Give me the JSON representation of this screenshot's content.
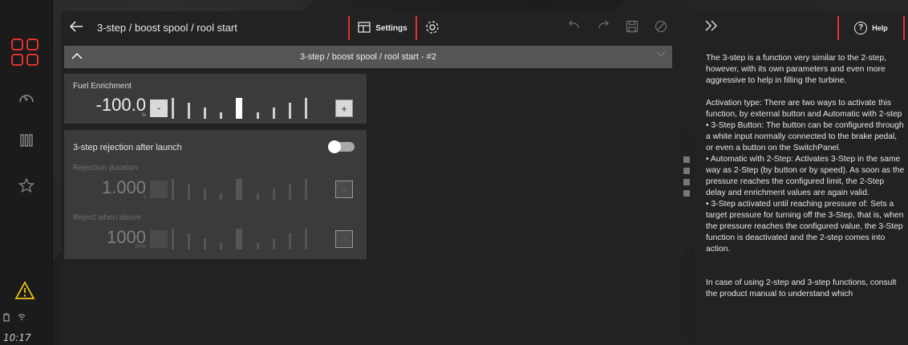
{
  "rail": {
    "clock": "10:17",
    "icons": [
      "dashboard-logo",
      "gauge-icon",
      "columns-icon",
      "star-icon",
      "warning-icon",
      "battery-icon",
      "wifi-icon"
    ]
  },
  "topbar": {
    "title": "3-step / boost spool / rool start",
    "settings_label": "Settings"
  },
  "subbar": {
    "title": "3-step / boost spool / rool start - #2"
  },
  "fuel": {
    "label": "Fuel Enrichment",
    "value": "-100.0",
    "unit": "%",
    "minus": "-",
    "plus": "+"
  },
  "rejection": {
    "toggle_label": "3-step rejection after launch",
    "toggle_on": false,
    "duration_label": "Rejection duration",
    "duration_value": "1.000",
    "duration_unit": "s",
    "above_label": "Reject when above",
    "above_value": "1000",
    "above_unit": "RPM",
    "minus": "-",
    "plus": "+"
  },
  "help": {
    "button_label": "Help",
    "paragraphs": [
      "The 3-step is a function very similar to the 2-step, however, with its own parameters and even more aggressive to help in filling the turbine.",
      "Activation type: There are two ways to activate this function, by external button and Automatic with 2-step",
      "• 3-Step Button: The button can be configured through a white input normally connected to the brake pedal, or even a button on the SwitchPanel.",
      "• Automatic with 2-Step: Activates 3-Step in the same way as 2-Step (by button or by speed). As soon as the pressure reaches the configured limit, the 2-Step delay and enrichment values are again valid.",
      "• 3-Step activated until reaching pressure of: Sets a target pressure for turning off the 3-Step, that is, when the pressure reaches the configured value, the 3-Step function is deactivated and the 2-step comes into action.",
      "In case of using 2-step and 3-step functions, consult the product manual to understand which"
    ]
  },
  "colors": {
    "accent": "#e0332e",
    "panel": "#222222",
    "card": "#3b3b3b"
  }
}
